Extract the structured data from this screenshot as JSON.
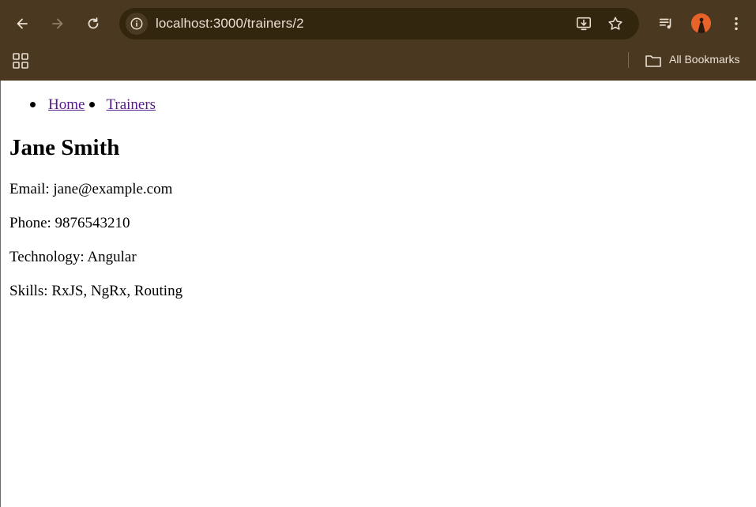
{
  "browser": {
    "url": "localhost:3000/trainers/2",
    "bookmarks_label": "All Bookmarks"
  },
  "nav": {
    "items": [
      {
        "label": "Home"
      },
      {
        "label": "Trainers"
      }
    ]
  },
  "trainer": {
    "name": "Jane Smith",
    "email": "Email: jane@example.com",
    "phone": "Phone: 9876543210",
    "technology": "Technology: Angular",
    "skills": "Skills: RxJS, NgRx, Routing"
  },
  "colors": {
    "chrome": "#4b3820",
    "omnibox": "#33260f",
    "link": "#551a8b",
    "avatar": "#e8632a"
  }
}
